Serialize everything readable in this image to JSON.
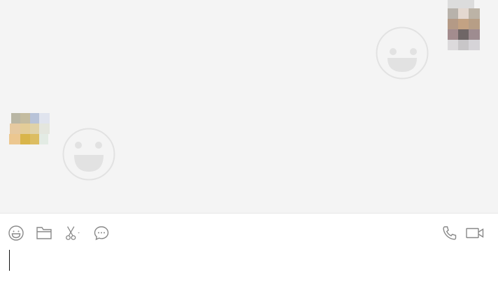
{
  "chat": {
    "messages": [
      {
        "sender": "self",
        "type": "sticker",
        "sticker": "smiley-face"
      },
      {
        "sender": "peer",
        "type": "sticker",
        "sticker": "smiley-face"
      }
    ]
  },
  "toolbar": {
    "left_tools": [
      "emoji-icon",
      "folder-icon",
      "scissors-icon",
      "chat-bubble-icon"
    ],
    "right_tools": [
      "phone-icon",
      "video-camera-icon"
    ]
  },
  "input": {
    "value": ""
  },
  "colors": {
    "chat_background": "#f4f4f4",
    "input_background": "#ffffff",
    "icon_color": "#888888",
    "sticker_color": "#e4e4e4"
  }
}
